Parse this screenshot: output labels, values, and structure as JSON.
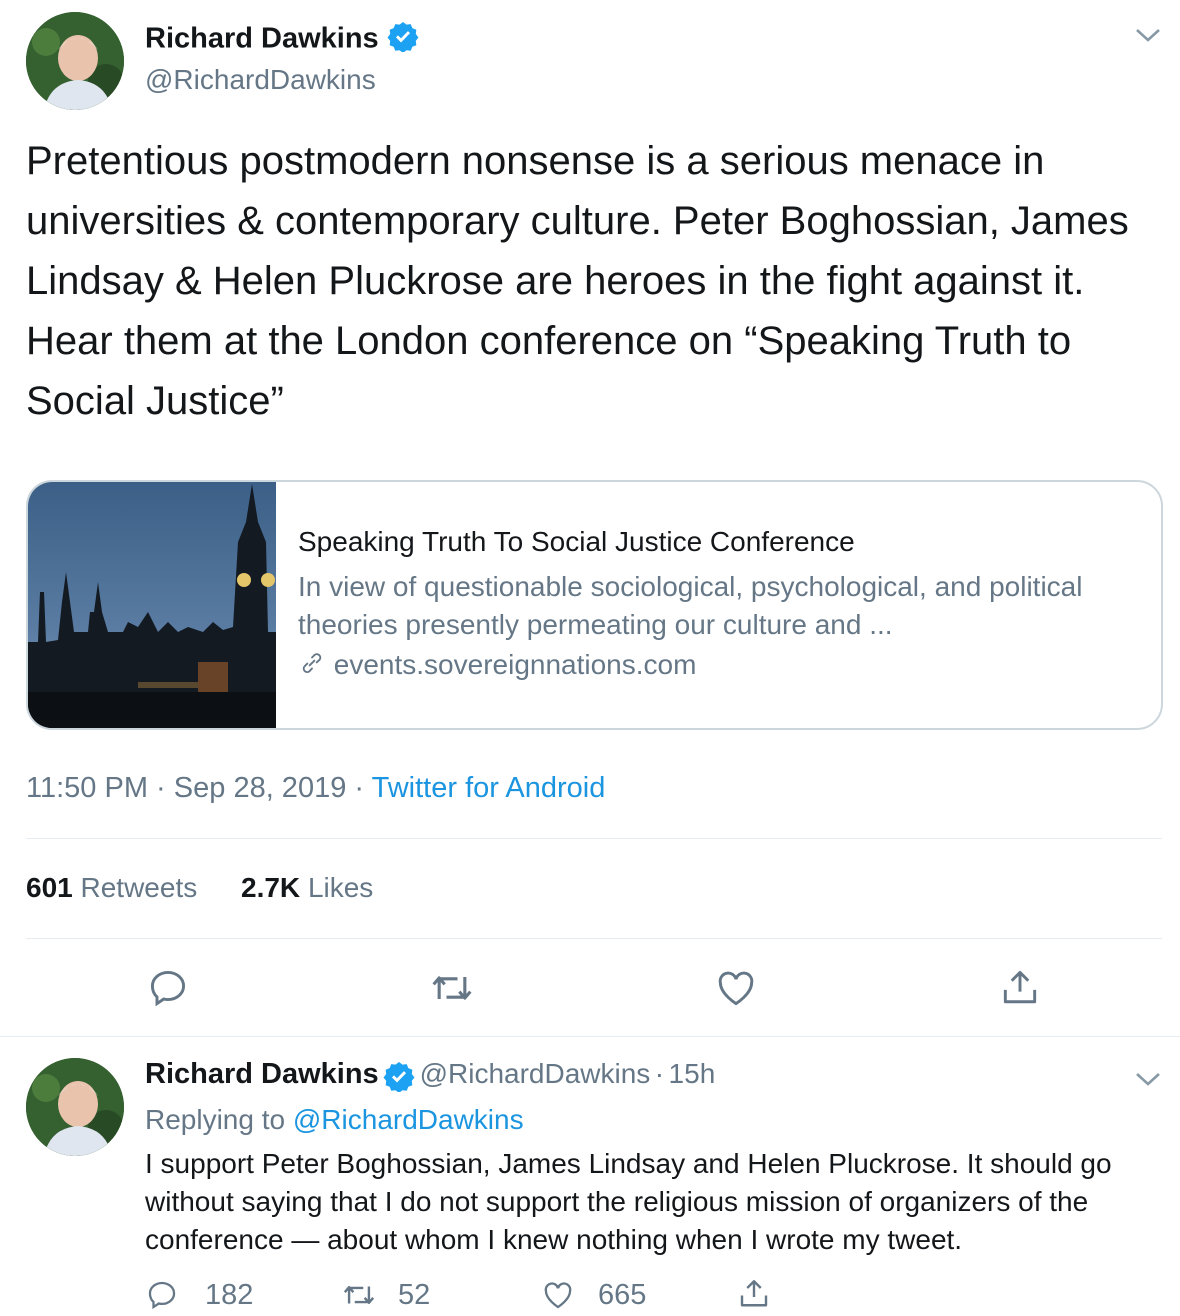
{
  "main_tweet": {
    "author_name": "Richard Dawkins",
    "author_handle": "@RichardDawkins",
    "text": "Pretentious postmodern nonsense is a serious menace in universities & contemporary culture. Peter Boghossian, James Lindsay & Helen Pluckrose are heroes in the fight against it. Hear them at the London conference on “Speaking Truth to Social Justice”",
    "card": {
      "title": "Speaking Truth To Social Justice Conference",
      "description": "In view of questionable sociological, psychological, and political theories presently permeating our culture and ...",
      "domain": "events.sovereignnations.com"
    },
    "time": "11:50 PM",
    "separator": "·",
    "date": "Sep 28, 2019",
    "source": "Twitter for Android",
    "retweets_count": "601",
    "retweets_label": "Retweets",
    "likes_count": "2.7K",
    "likes_label": "Likes"
  },
  "reply_tweet": {
    "author_name": "Richard Dawkins",
    "author_handle": "@RichardDawkins",
    "age": "15h",
    "separator": "·",
    "replying_prefix": "Replying to",
    "replying_handle": "@RichardDawkins",
    "text": "I support Peter Boghossian, James Lindsay and Helen Pluckrose. It should go without saying that I do not support the religious mission of organizers of the conference — about whom I knew nothing when I wrote my tweet.",
    "reply_count": "182",
    "retweet_count": "52",
    "like_count": "665"
  },
  "icons": [
    "verified-badge-icon",
    "chevron-down-icon",
    "reply-icon",
    "retweet-icon",
    "like-icon",
    "share-icon",
    "link-icon"
  ],
  "colors": {
    "accent": "#1da1f2",
    "link": "#1b95e0",
    "secondary_text": "#657786",
    "divider": "#e6ecf0"
  }
}
